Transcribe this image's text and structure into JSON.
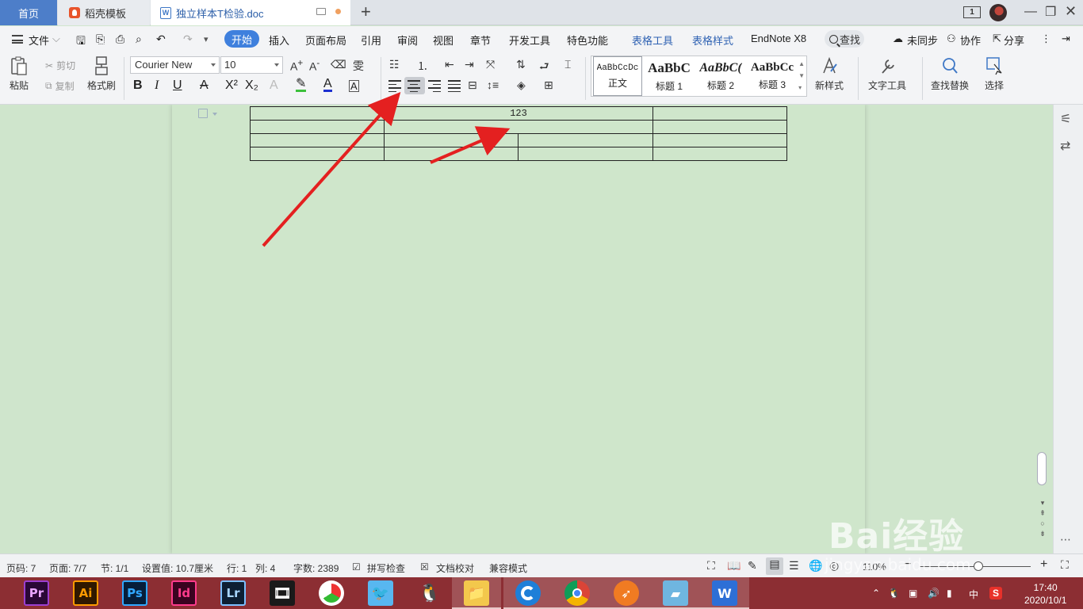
{
  "tabs": {
    "home": "首页",
    "docer": "稻壳模板",
    "document": "独立样本T检验.doc",
    "new_tab": "+",
    "window_count": "1"
  },
  "menu": {
    "file": "文件",
    "items": [
      "开始",
      "插入",
      "页面布局",
      "引用",
      "审阅",
      "视图",
      "章节",
      "开发工具",
      "特色功能",
      "表格工具",
      "表格样式",
      "EndNote X8"
    ],
    "search": "查找",
    "sync": "未同步",
    "collab": "协作",
    "share": "分享"
  },
  "ribbon": {
    "paste": "粘贴",
    "cut": "剪切",
    "copy": "复制",
    "format_painter": "格式刷",
    "font_name": "Courier New",
    "font_size": "10",
    "new_style": "新样式",
    "text_tools": "文字工具",
    "find_replace": "查找替换",
    "select": "选择",
    "styles": [
      {
        "preview": "AaBbCcDc",
        "label": "正文"
      },
      {
        "preview": "AaBbC",
        "label": "标题 1"
      },
      {
        "preview": "AaBbC(",
        "label": "标题 2"
      },
      {
        "preview": "AaBbCc",
        "label": "标题 3"
      }
    ]
  },
  "table": {
    "rows": [
      [
        "",
        "123",
        "",
        ""
      ],
      [
        "",
        "",
        "",
        ""
      ],
      [
        "",
        "",
        "",
        ""
      ],
      [
        "",
        "",
        "",
        ""
      ]
    ]
  },
  "status": {
    "page_num": "页码: 7",
    "pages": "页面: 7/7",
    "section": "节: 1/1",
    "setting": "设置值: 10.7厘米",
    "row": "行: 1",
    "col": "列: 4",
    "words": "字数: 2389",
    "spell": "拼写检查",
    "proof": "文档校对",
    "compat": "兼容模式",
    "zoom": "110%"
  },
  "taskbar": {
    "apps": [
      "Pr",
      "Ai",
      "Ps",
      "Id",
      "Lr"
    ],
    "ime": "中",
    "time": "17:40",
    "date": "2020/10/1"
  },
  "watermark": {
    "brand": "Bai经验",
    "url": "jingyan.baidu.com"
  }
}
